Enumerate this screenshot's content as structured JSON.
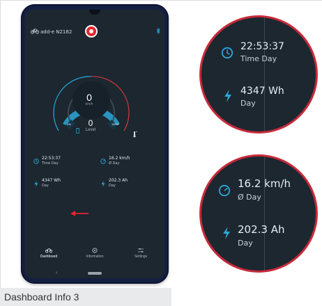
{
  "caption": "Dashboard Info 3",
  "app": {
    "device_name": "add-e N2182",
    "speed": "0",
    "speed_unit": "km/h",
    "level": "0",
    "level_label": "Level",
    "gauge_min_label": "0%",
    "gauge_max_label": "100%",
    "info": {
      "time_value": "22:53:37",
      "time_label": "Time Day",
      "speed_value": "16.2 km/h",
      "speed_label": "Ø Day",
      "energy_value": "4347 Wh",
      "energy_label": "Day",
      "charge_value": "202.3 Ah",
      "charge_label": "Day"
    },
    "nav": {
      "dashboard": "Dashboard",
      "information": "Information",
      "settings": "Settings"
    }
  },
  "zoom_top": {
    "time_value": "22:53:37",
    "time_label": "Time Day",
    "energy_value": "4347 Wh",
    "energy_label": "Day"
  },
  "zoom_bottom": {
    "speed_value": "16.2 km/h",
    "speed_label": "Ø Day",
    "charge_value": "202.3 Ah",
    "charge_label": "Day"
  },
  "colors": {
    "accent_blue": "#2aa8d8",
    "accent_red": "#d4373f",
    "screen_bg": "#1c2730",
    "highlight_ring": "#c62a3a"
  }
}
